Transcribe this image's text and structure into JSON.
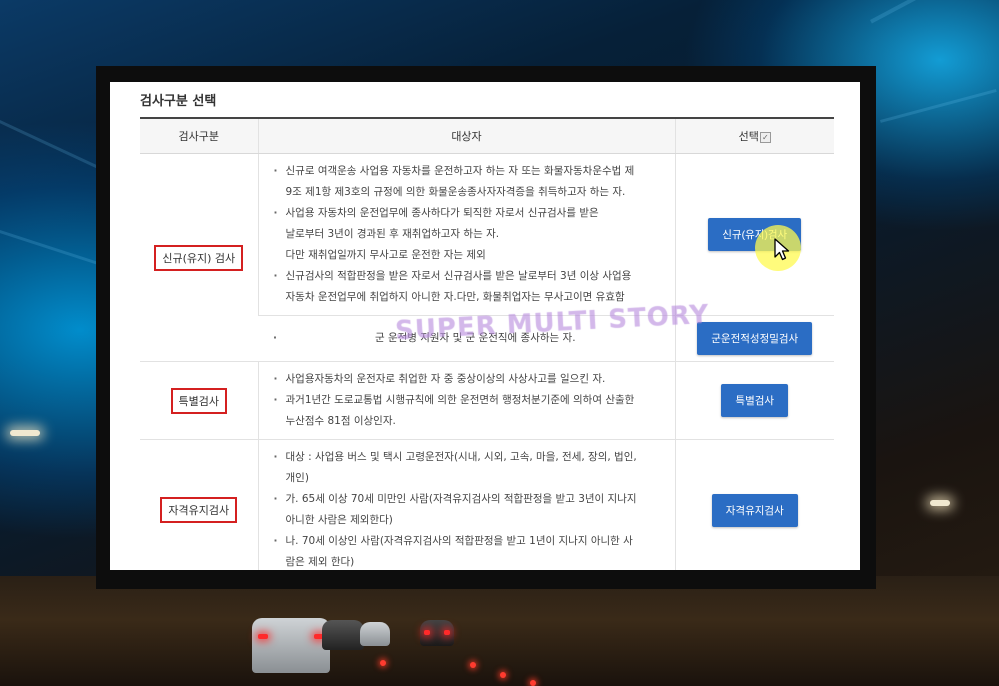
{
  "panel": {
    "section_title": "검사구분 선택",
    "watermark": "SUPER MULTI STORY"
  },
  "table": {
    "headers": [
      "검사구분",
      "대상자",
      "선택"
    ],
    "rows": [
      {
        "type": "신규(유지) 검사",
        "items": [
          [
            "신규로 여객운송 사업용 자동차를 운전하고자 하는 자 또는 화물자동차운수법 제",
            "9조 제1항 제3호의 규정에 의한 화물운송종사자자격증을 취득하고자 하는 자."
          ],
          [
            "사업용 자동차의 운전업무에 종사하다가 퇴직한 자로서 신규검사를 받은",
            "날로부터 3년이 경과된 후 재취업하고자 하는 자.",
            "다만 재취업일까지 무사고로 운전한 자는 제외"
          ],
          [
            "신규검사의 적합판정을 받은 자로서 신규검사를 받은 날로부터 3년 이상 사업용",
            "자동차 운전업무에 취업하지 아니한 자.다만, 화물취업자는 무사고이면 유효함"
          ]
        ],
        "button": "신규(유지)검사"
      },
      {
        "items": [
          [
            "군 운전병 지원자 및 군 운전직에 종사하는 자."
          ]
        ],
        "button": "군운전적성정밀검사"
      },
      {
        "type": "특별검사",
        "items": [
          [
            "사업용자동차의 운전자로 취업한 자 중 중상이상의 사상사고를 일으킨 자."
          ],
          [
            "과거1년간 도로교통법 시행규칙에 의한 운전면허 행정처분기준에 의하여 산출한",
            "누산점수 81점 이상인자."
          ]
        ],
        "button": "특별검사"
      },
      {
        "type": "자격유지검사",
        "items": [
          [
            "대상 : 사업용 버스 및 택시 고령운전자(시내, 시외, 고속, 마을, 전세, 장의, 법인,",
            "개인)"
          ],
          [
            "가. 65세 이상 70세 미만인 사람(자격유지검사의 적합판정을 받고 3년이 지나지",
            "아니한 사람은 제외한다)"
          ],
          [
            "나. 70세 이상인 사람(자격유지검사의 적합판정을 받고 1년이 지나지 아니한 사",
            "람은 제외 한다)"
          ]
        ],
        "button": "자격유지검사"
      }
    ]
  },
  "icons": {
    "check": "checkbox-icon",
    "cursor": "mouse-pointer-icon"
  },
  "colors": {
    "button": "#2b6dc4",
    "highlight_box": "#d42020",
    "cursor_halo": "#fffa50"
  }
}
